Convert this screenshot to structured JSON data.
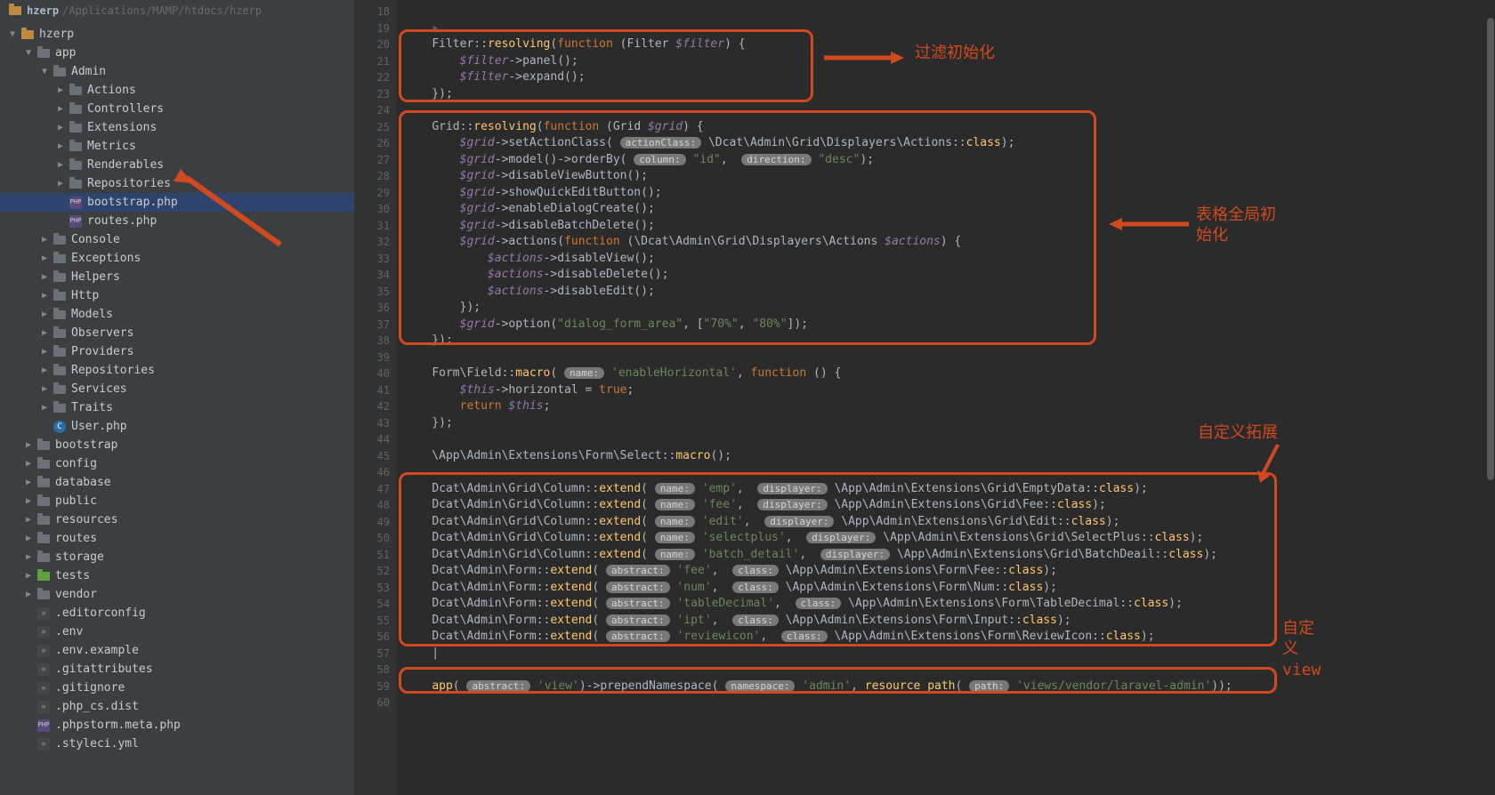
{
  "header": {
    "project": "hzerp",
    "path": "/Applications/MAMP/htdocs/hzerp"
  },
  "tree": [
    {
      "d": 0,
      "t": "folder",
      "c": "hl",
      "exp": "down",
      "label": "hzerp"
    },
    {
      "d": 1,
      "t": "folder",
      "c": "",
      "exp": "down",
      "label": "app"
    },
    {
      "d": 2,
      "t": "folder",
      "c": "",
      "exp": "down",
      "label": "Admin"
    },
    {
      "d": 3,
      "t": "folder",
      "c": "",
      "exp": "right",
      "label": "Actions"
    },
    {
      "d": 3,
      "t": "folder",
      "c": "",
      "exp": "right",
      "label": "Controllers"
    },
    {
      "d": 3,
      "t": "folder",
      "c": "",
      "exp": "right",
      "label": "Extensions"
    },
    {
      "d": 3,
      "t": "folder",
      "c": "",
      "exp": "right",
      "label": "Metrics"
    },
    {
      "d": 3,
      "t": "folder",
      "c": "",
      "exp": "right",
      "label": "Renderables"
    },
    {
      "d": 3,
      "t": "folder",
      "c": "",
      "exp": "right",
      "label": "Repositories"
    },
    {
      "d": 3,
      "t": "php",
      "label": "bootstrap.php",
      "sel": true
    },
    {
      "d": 3,
      "t": "php",
      "label": "routes.php"
    },
    {
      "d": 2,
      "t": "folder",
      "c": "",
      "exp": "right",
      "label": "Console"
    },
    {
      "d": 2,
      "t": "folder",
      "c": "",
      "exp": "right",
      "label": "Exceptions"
    },
    {
      "d": 2,
      "t": "folder",
      "c": "",
      "exp": "right",
      "label": "Helpers"
    },
    {
      "d": 2,
      "t": "folder",
      "c": "",
      "exp": "right",
      "label": "Http"
    },
    {
      "d": 2,
      "t": "folder",
      "c": "",
      "exp": "right",
      "label": "Models"
    },
    {
      "d": 2,
      "t": "folder",
      "c": "",
      "exp": "right",
      "label": "Observers"
    },
    {
      "d": 2,
      "t": "folder",
      "c": "",
      "exp": "right",
      "label": "Providers"
    },
    {
      "d": 2,
      "t": "folder",
      "c": "",
      "exp": "right",
      "label": "Repositories"
    },
    {
      "d": 2,
      "t": "folder",
      "c": "",
      "exp": "right",
      "label": "Services"
    },
    {
      "d": 2,
      "t": "folder",
      "c": "",
      "exp": "right",
      "label": "Traits"
    },
    {
      "d": 2,
      "t": "cls",
      "label": "User.php"
    },
    {
      "d": 1,
      "t": "folder",
      "c": "",
      "exp": "right",
      "label": "bootstrap"
    },
    {
      "d": 1,
      "t": "folder",
      "c": "",
      "exp": "right",
      "label": "config"
    },
    {
      "d": 1,
      "t": "folder",
      "c": "",
      "exp": "right",
      "label": "database"
    },
    {
      "d": 1,
      "t": "folder",
      "c": "",
      "exp": "right",
      "label": "public"
    },
    {
      "d": 1,
      "t": "folder",
      "c": "",
      "exp": "right",
      "label": "resources"
    },
    {
      "d": 1,
      "t": "folder",
      "c": "",
      "exp": "right",
      "label": "routes"
    },
    {
      "d": 1,
      "t": "folder",
      "c": "",
      "exp": "right",
      "label": "storage"
    },
    {
      "d": 1,
      "t": "folder",
      "c": "green",
      "exp": "right",
      "label": "tests"
    },
    {
      "d": 1,
      "t": "folder",
      "c": "",
      "exp": "right",
      "label": "vendor"
    },
    {
      "d": 1,
      "t": "txt",
      "label": ".editorconfig"
    },
    {
      "d": 1,
      "t": "txt",
      "label": ".env"
    },
    {
      "d": 1,
      "t": "txt",
      "label": ".env.example"
    },
    {
      "d": 1,
      "t": "txt",
      "label": ".gitattributes"
    },
    {
      "d": 1,
      "t": "txt",
      "label": ".gitignore"
    },
    {
      "d": 1,
      "t": "txt",
      "label": ".php_cs.dist"
    },
    {
      "d": 1,
      "t": "php",
      "label": ".phpstorm.meta.php"
    },
    {
      "d": 1,
      "t": "txt",
      "label": ".styleci.yml"
    }
  ],
  "gutter": {
    "start": 18,
    "end": 60
  },
  "annotations": {
    "a1": "过滤初始化",
    "a2": "表格全局初始化",
    "a3": "自定义拓展",
    "a4": "自定义view"
  },
  "code": {
    "l18": "",
    "l19": "    ▸",
    "l20": "    Filter::resolving(function (Filter $filter) {",
    "l21": "        $filter->panel();",
    "l22": "        $filter->expand();",
    "l23": "    });",
    "l24": "",
    "l25": "    Grid::resolving(function (Grid $grid) {",
    "l26": "        $grid->setActionClass( actionClass: \\Dcat\\Admin\\Grid\\Displayers\\Actions::class);",
    "l27": "        $grid->model()->orderBy( column: \"id\",  direction: \"desc\");",
    "l28": "        $grid->disableViewButton();",
    "l29": "        $grid->showQuickEditButton();",
    "l30": "        $grid->enableDialogCreate();",
    "l31": "        $grid->disableBatchDelete();",
    "l32": "        $grid->actions(function (\\Dcat\\Admin\\Grid\\Displayers\\Actions $actions) {",
    "l33": "            $actions->disableView();",
    "l34": "            $actions->disableDelete();",
    "l35": "            $actions->disableEdit();",
    "l36": "        });",
    "l37": "        $grid->option(\"dialog_form_area\", [\"70%\", \"80%\"]);",
    "l38": "    });",
    "l39": "",
    "l40": "    Form\\Field::macro( name: 'enableHorizontal', function () {",
    "l41": "        $this->horizontal = true;",
    "l42": "        return $this;",
    "l43": "    });",
    "l44": "",
    "l45": "    \\App\\Admin\\Extensions\\Form\\Select::macro();",
    "l46": "",
    "l47": "    Dcat\\Admin\\Grid\\Column::extend( name: 'emp',  displayer: \\App\\Admin\\Extensions\\Grid\\EmptyData::class);",
    "l48": "    Dcat\\Admin\\Grid\\Column::extend( name: 'fee',  displayer: \\App\\Admin\\Extensions\\Grid\\Fee::class);",
    "l49": "    Dcat\\Admin\\Grid\\Column::extend( name: 'edit',  displayer: \\App\\Admin\\Extensions\\Grid\\Edit::class);",
    "l50": "    Dcat\\Admin\\Grid\\Column::extend( name: 'selectplus',  displayer: \\App\\Admin\\Extensions\\Grid\\SelectPlus::class);",
    "l51": "    Dcat\\Admin\\Grid\\Column::extend( name: 'batch_detail',  displayer: \\App\\Admin\\Extensions\\Grid\\BatchDeail::class);",
    "l52": "    Dcat\\Admin\\Form::extend( abstract: 'fee',  class: \\App\\Admin\\Extensions\\Form\\Fee::class);",
    "l53": "    Dcat\\Admin\\Form::extend( abstract: 'num',  class: \\App\\Admin\\Extensions\\Form\\Num::class);",
    "l54": "    Dcat\\Admin\\Form::extend( abstract: 'tableDecimal',  class: \\App\\Admin\\Extensions\\Form\\TableDecimal::class);",
    "l55": "    Dcat\\Admin\\Form::extend( abstract: 'ipt',  class: \\App\\Admin\\Extensions\\Form\\Input::class);",
    "l56": "    Dcat\\Admin\\Form::extend( abstract: 'reviewicon',  class: \\App\\Admin\\Extensions\\Form\\ReviewIcon::class);",
    "l57": "    |",
    "l58": "",
    "l59": "    app( abstract: 'view')->prependNamespace( namespace: 'admin', resource_path( path: 'views/vendor/laravel-admin'));",
    "l60": ""
  }
}
